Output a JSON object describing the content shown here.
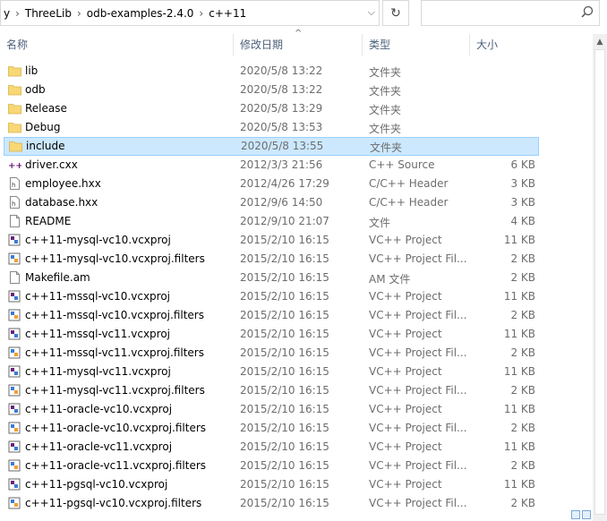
{
  "address": {
    "prefix": "y",
    "crumbs": [
      "ThreeLib",
      "odb-examples-2.4.0",
      "c++11"
    ],
    "dropdown_icon": "chevron-down-icon",
    "refresh_icon": "refresh-icon",
    "search_icon": "search-icon",
    "search_placeholder": ""
  },
  "columns": {
    "name": "名称",
    "date": "修改日期",
    "type": "类型",
    "size": "大小"
  },
  "files": [
    {
      "name": "lib",
      "date": "2020/5/8 13:22",
      "type": "文件夹",
      "size": "",
      "icon": "folder-icon"
    },
    {
      "name": "odb",
      "date": "2020/5/8 13:22",
      "type": "文件夹",
      "size": "",
      "icon": "folder-icon"
    },
    {
      "name": "Release",
      "date": "2020/5/8 13:29",
      "type": "文件夹",
      "size": "",
      "icon": "folder-icon"
    },
    {
      "name": "Debug",
      "date": "2020/5/8 13:53",
      "type": "文件夹",
      "size": "",
      "icon": "folder-icon"
    },
    {
      "name": "include",
      "date": "2020/5/8 13:55",
      "type": "文件夹",
      "size": "",
      "icon": "folder-icon",
      "selected": true
    },
    {
      "name": "driver.cxx",
      "date": "2012/3/3 21:56",
      "type": "C++ Source",
      "size": "6 KB",
      "icon": "cpp-source-icon"
    },
    {
      "name": "employee.hxx",
      "date": "2012/4/26 17:29",
      "type": "C/C++ Header",
      "size": "3 KB",
      "icon": "header-file-icon"
    },
    {
      "name": "database.hxx",
      "date": "2012/9/6 14:50",
      "type": "C/C++ Header",
      "size": "3 KB",
      "icon": "header-file-icon"
    },
    {
      "name": "README",
      "date": "2012/9/10 21:07",
      "type": "文件",
      "size": "4 KB",
      "icon": "file-icon"
    },
    {
      "name": "c++11-mysql-vc10.vcxproj",
      "date": "2015/2/10 16:15",
      "type": "VC++ Project",
      "size": "11 KB",
      "icon": "vcxproj-icon"
    },
    {
      "name": "c++11-mysql-vc10.vcxproj.filters",
      "date": "2015/2/10 16:15",
      "type": "VC++ Project Fil...",
      "size": "2 KB",
      "icon": "vcxproj-filters-icon"
    },
    {
      "name": "Makefile.am",
      "date": "2015/2/10 16:15",
      "type": "AM 文件",
      "size": "2 KB",
      "icon": "file-icon"
    },
    {
      "name": "c++11-mssql-vc10.vcxproj",
      "date": "2015/2/10 16:15",
      "type": "VC++ Project",
      "size": "11 KB",
      "icon": "vcxproj-icon"
    },
    {
      "name": "c++11-mssql-vc10.vcxproj.filters",
      "date": "2015/2/10 16:15",
      "type": "VC++ Project Fil...",
      "size": "2 KB",
      "icon": "vcxproj-filters-icon"
    },
    {
      "name": "c++11-mssql-vc11.vcxproj",
      "date": "2015/2/10 16:15",
      "type": "VC++ Project",
      "size": "11 KB",
      "icon": "vcxproj-icon"
    },
    {
      "name": "c++11-mssql-vc11.vcxproj.filters",
      "date": "2015/2/10 16:15",
      "type": "VC++ Project Fil...",
      "size": "2 KB",
      "icon": "vcxproj-filters-icon"
    },
    {
      "name": "c++11-mysql-vc11.vcxproj",
      "date": "2015/2/10 16:15",
      "type": "VC++ Project",
      "size": "11 KB",
      "icon": "vcxproj-icon"
    },
    {
      "name": "c++11-mysql-vc11.vcxproj.filters",
      "date": "2015/2/10 16:15",
      "type": "VC++ Project Fil...",
      "size": "2 KB",
      "icon": "vcxproj-filters-icon"
    },
    {
      "name": "c++11-oracle-vc10.vcxproj",
      "date": "2015/2/10 16:15",
      "type": "VC++ Project",
      "size": "11 KB",
      "icon": "vcxproj-icon"
    },
    {
      "name": "c++11-oracle-vc10.vcxproj.filters",
      "date": "2015/2/10 16:15",
      "type": "VC++ Project Fil...",
      "size": "2 KB",
      "icon": "vcxproj-filters-icon"
    },
    {
      "name": "c++11-oracle-vc11.vcxproj",
      "date": "2015/2/10 16:15",
      "type": "VC++ Project",
      "size": "11 KB",
      "icon": "vcxproj-icon"
    },
    {
      "name": "c++11-oracle-vc11.vcxproj.filters",
      "date": "2015/2/10 16:15",
      "type": "VC++ Project Fil...",
      "size": "2 KB",
      "icon": "vcxproj-filters-icon"
    },
    {
      "name": "c++11-pgsql-vc10.vcxproj",
      "date": "2015/2/10 16:15",
      "type": "VC++ Project",
      "size": "11 KB",
      "icon": "vcxproj-icon"
    },
    {
      "name": "c++11-pgsql-vc10.vcxproj.filters",
      "date": "2015/2/10 16:15",
      "type": "VC++ Project Fil...",
      "size": "2 KB",
      "icon": "vcxproj-filters-icon"
    }
  ],
  "colors": {
    "selection_bg": "#cce8ff",
    "selection_border": "#99d1ff",
    "folder": "#f8d775",
    "header_text": "#4c607a"
  }
}
